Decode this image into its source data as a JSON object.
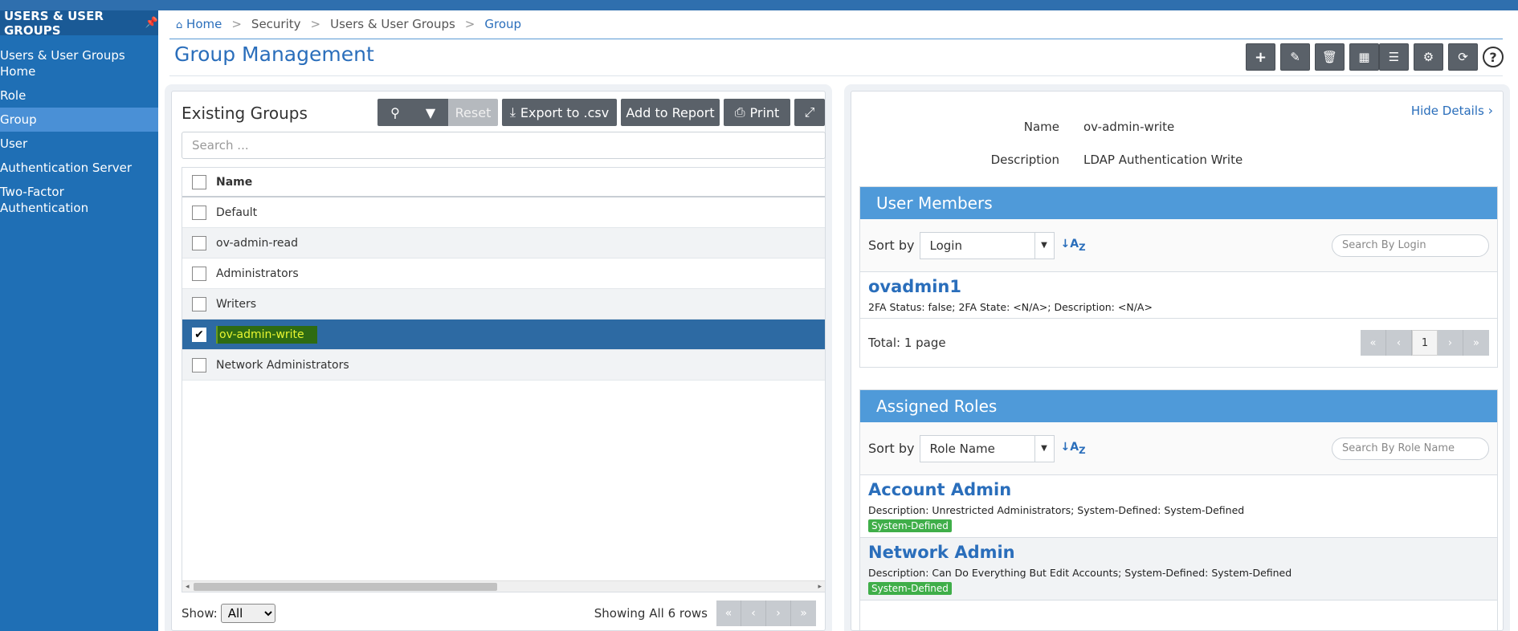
{
  "sidebar": {
    "header": "USERS & USER GROUPS",
    "items": [
      {
        "label": "Users & User Groups Home"
      },
      {
        "label": "Role"
      },
      {
        "label": "Group"
      },
      {
        "label": "User"
      },
      {
        "label": "Authentication Server"
      },
      {
        "label": "Two-Factor Authentication"
      }
    ]
  },
  "breadcrumb": {
    "home": "Home",
    "items": [
      "Security",
      "Users & User Groups",
      "Group"
    ],
    "separator": ">"
  },
  "page": {
    "title": "Group Management"
  },
  "groups": {
    "title": "Existing Groups",
    "reset_label": "Reset",
    "export_label": "Export to .csv",
    "add_report_label": "Add to Report",
    "print_label": "Print",
    "search_placeholder": "Search ...",
    "column_name": "Name",
    "rows": [
      {
        "name": "Default",
        "checked": false
      },
      {
        "name": "ov-admin-read",
        "checked": false
      },
      {
        "name": "Administrators",
        "checked": false
      },
      {
        "name": "Writers",
        "checked": false
      },
      {
        "name": "ov-admin-write",
        "checked": true
      },
      {
        "name": "Network Administrators",
        "checked": false
      }
    ],
    "show_label": "Show:",
    "show_value": "All",
    "rows_info": "Showing All 6 rows"
  },
  "details": {
    "hide_label": "Hide Details",
    "name_label": "Name",
    "name_value": "ov-admin-write",
    "desc_label": "Description",
    "desc_value": "LDAP Authentication Write",
    "members": {
      "title": "User Members",
      "sort_label": "Sort by",
      "sort_value": "Login",
      "search_placeholder": "Search By Login",
      "items": [
        {
          "name": "ovadmin1",
          "desc": "2FA Status: false; 2FA State: <N/A>; Description: <N/A>"
        }
      ],
      "total": "Total: 1 page",
      "page": "1"
    },
    "roles": {
      "title": "Assigned Roles",
      "sort_label": "Sort by",
      "sort_value": "Role Name",
      "search_placeholder": "Search By Role Name",
      "items": [
        {
          "name": "Account Admin",
          "desc": "Description: Unrestricted Administrators; System-Defined: System-Defined",
          "badge": "System-Defined"
        },
        {
          "name": "Network Admin",
          "desc": "Description: Can Do Everything But Edit Accounts; System-Defined: System-Defined",
          "badge": "System-Defined"
        }
      ]
    }
  },
  "colors": {
    "sidebar": "#1f6fb5",
    "accent": "#2a6ebb",
    "section_header": "#4f9ad9",
    "selected_row": "#2d6aa3",
    "badge": "#3fae49"
  }
}
